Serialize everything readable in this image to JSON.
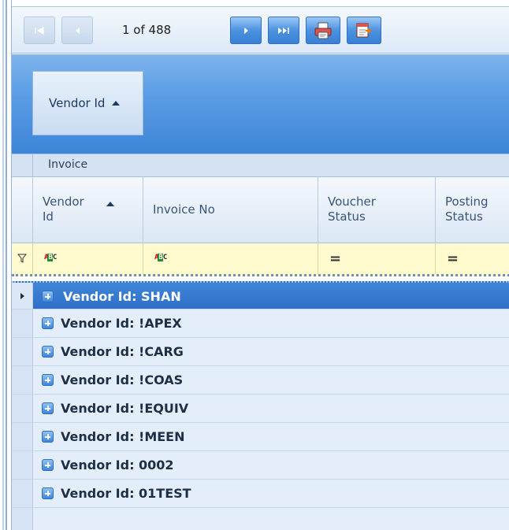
{
  "pager": {
    "first_icon": "first-page-icon",
    "prev_icon": "prev-page-icon",
    "position_text": "1 of 488",
    "next_icon": "next-page-icon",
    "last_icon": "last-page-icon",
    "print_icon": "print-icon",
    "export_icon": "export-icon"
  },
  "group_panel": {
    "chip_label": "Vendor Id"
  },
  "band": {
    "label": "Invoice"
  },
  "columns": {
    "vendor_id_line1": "Vendor",
    "vendor_id_line2": "Id",
    "invoice_no": "Invoice No",
    "voucher_status_line1": "Voucher",
    "voucher_status_line2": "Status",
    "posting_status_line1": "Posting",
    "posting_status_line2": "Status"
  },
  "filter_row": {
    "text_operator": "ABC",
    "equals_operator": "="
  },
  "groups": [
    {
      "label": "Vendor Id:  SHAN",
      "selected": true
    },
    {
      "label": "Vendor Id: !APEX"
    },
    {
      "label": "Vendor Id: !CARG"
    },
    {
      "label": "Vendor Id: !COAS"
    },
    {
      "label": "Vendor Id: !EQUIV"
    },
    {
      "label": "Vendor Id: !MEEN"
    },
    {
      "label": "Vendor Id: 0002"
    },
    {
      "label": "Vendor Id: 01TEST"
    }
  ],
  "colors": {
    "selection": "#3a7ed4",
    "group_panel": "#5fa0e6",
    "filter_bg": "#fffbcf"
  }
}
